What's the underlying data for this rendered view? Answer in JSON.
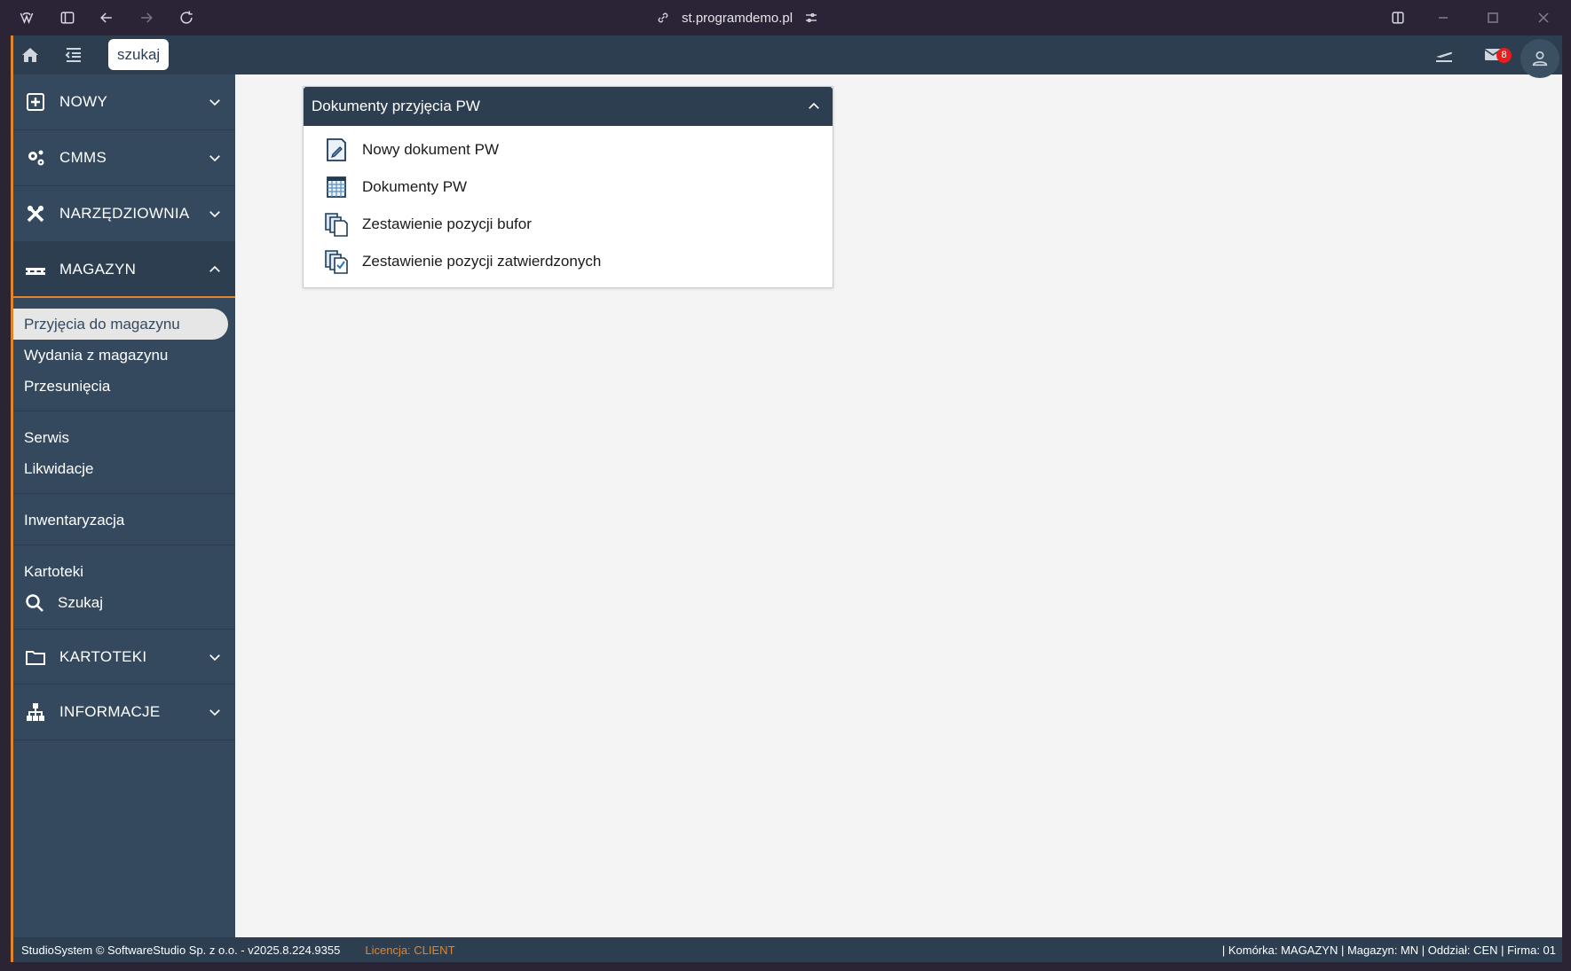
{
  "browser": {
    "url": "st.programdemo.pl"
  },
  "topbar": {
    "search_label": "szukaj",
    "mail_badge": "8"
  },
  "sidebar": {
    "sections": [
      {
        "label": "NOWY",
        "icon": "plus-square-icon"
      },
      {
        "label": "CMMS",
        "icon": "gears-icon"
      },
      {
        "label": "NARZĘDZIOWNIA",
        "icon": "tools-icon"
      },
      {
        "label": "MAGAZYN",
        "icon": "pallet-icon"
      },
      {
        "label": "KARTOTEKI",
        "icon": "folder-icon"
      },
      {
        "label": "INFORMACJE",
        "icon": "hierarchy-icon"
      }
    ],
    "magazyn_items": {
      "przyjecia": "Przyjęcia do magazynu",
      "wydania": "Wydania z magazynu",
      "przesuniecia": "Przesunięcia",
      "serwis": "Serwis",
      "likwidacje": "Likwidacje",
      "inwentaryzacja": "Inwentaryzacja",
      "kartoteki": "Kartoteki",
      "szukaj": "Szukaj"
    }
  },
  "panel": {
    "title": "Dokumenty przyjęcia PW",
    "items": [
      {
        "label": "Nowy dokument PW",
        "icon": "edit-document-icon"
      },
      {
        "label": "Dokumenty PW",
        "icon": "table-document-icon"
      },
      {
        "label": "Zestawienie pozycji bufor",
        "icon": "copy-documents-icon"
      },
      {
        "label": "Zestawienie pozycji zatwierdzonych",
        "icon": "approved-documents-icon"
      }
    ]
  },
  "footer": {
    "copyright": "StudioSystem © SoftwareStudio Sp. z o.o. - v2025.8.224.9355",
    "license": "Licencja: CLIENT",
    "context": "| Komórka: MAGAZYN | Magazyn: MN | Oddział: CEN | Firma: 01"
  },
  "colors": {
    "accent": "#e2852a",
    "sidebar": "#34495e",
    "header": "#2c3e50",
    "badge": "#e81e1e"
  }
}
